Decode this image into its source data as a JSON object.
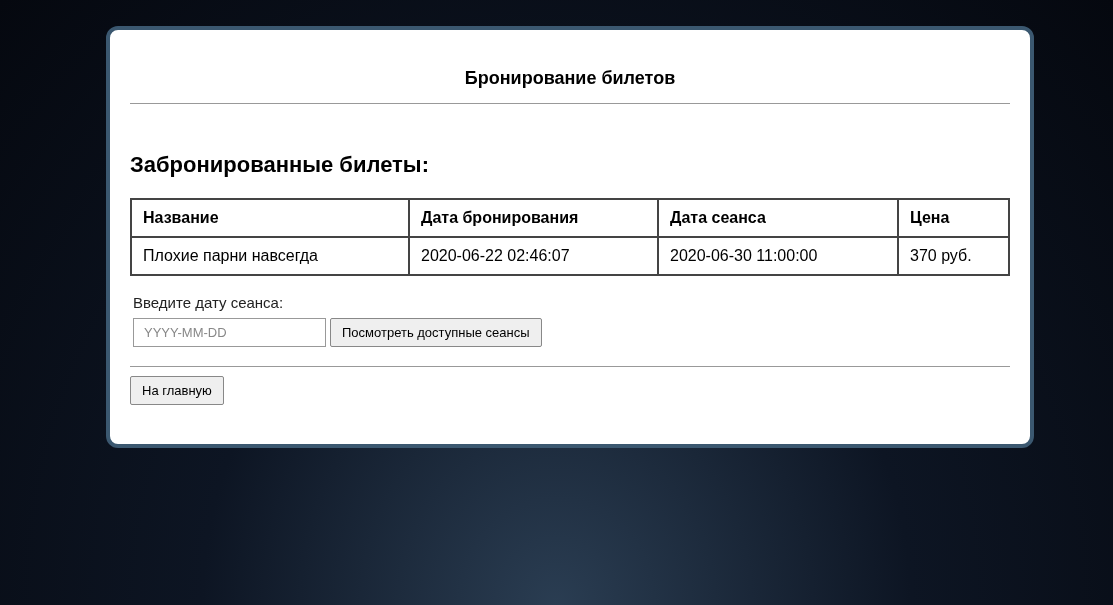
{
  "header": {
    "title": "Бронирование билетов"
  },
  "bookings": {
    "heading": "Забронированные билеты:",
    "columns": [
      "Название",
      "Дата бронирования",
      "Дата сеанса",
      "Цена"
    ],
    "rows": [
      [
        "Плохие парни навсегда",
        "2020-06-22 02:46:07",
        "2020-06-30 11:00:00",
        "370 руб."
      ]
    ]
  },
  "session_form": {
    "label": "Введите дату сеанса:",
    "placeholder": "YYYY-MM-DD",
    "button": "Посмотреть доступные сеансы"
  },
  "home_button": "На главную"
}
